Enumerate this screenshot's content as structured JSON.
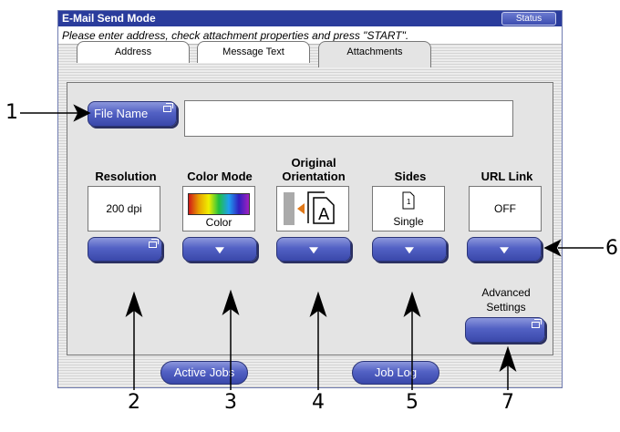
{
  "window": {
    "title": "E-Mail Send Mode",
    "status_label": "Status",
    "instruction": "Please enter address, check attachment properties and press \"START\"."
  },
  "tabs": [
    {
      "label": "Address"
    },
    {
      "label": "Message Text"
    },
    {
      "label": "Attachments",
      "active": true
    }
  ],
  "file_name": {
    "button_label": "File Name",
    "value": ""
  },
  "settings": [
    {
      "label": "Resolution",
      "value": "200 dpi"
    },
    {
      "label": "Color Mode",
      "value": "Color"
    },
    {
      "label": "Original\nOrientation",
      "value": ""
    },
    {
      "label": "Sides",
      "value": "Single"
    },
    {
      "label": "URL Link",
      "value": "OFF"
    }
  ],
  "advanced": {
    "label": "Advanced\nSettings"
  },
  "footer": {
    "active_jobs": "Active Jobs",
    "job_log": "Job Log"
  },
  "callouts": [
    "1",
    "2",
    "3",
    "4",
    "5",
    "6",
    "7"
  ],
  "colors": {
    "titlebar": "#2a3c9c",
    "button": "#5261c4",
    "orientation_arrow": "#e07818"
  }
}
